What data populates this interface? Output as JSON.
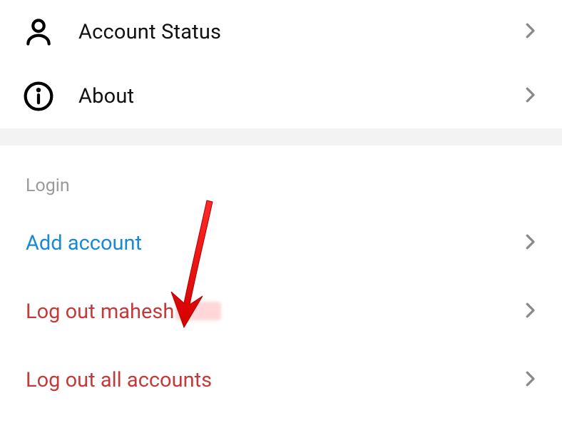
{
  "menu": {
    "accountStatus": {
      "label": "Account Status"
    },
    "about": {
      "label": "About"
    }
  },
  "login": {
    "header": "Login",
    "addAccount": {
      "label": "Add account"
    },
    "logoutUser": {
      "prefix": "Log out ",
      "username": "mahesh"
    },
    "logoutAll": {
      "label": "Log out all accounts"
    }
  }
}
